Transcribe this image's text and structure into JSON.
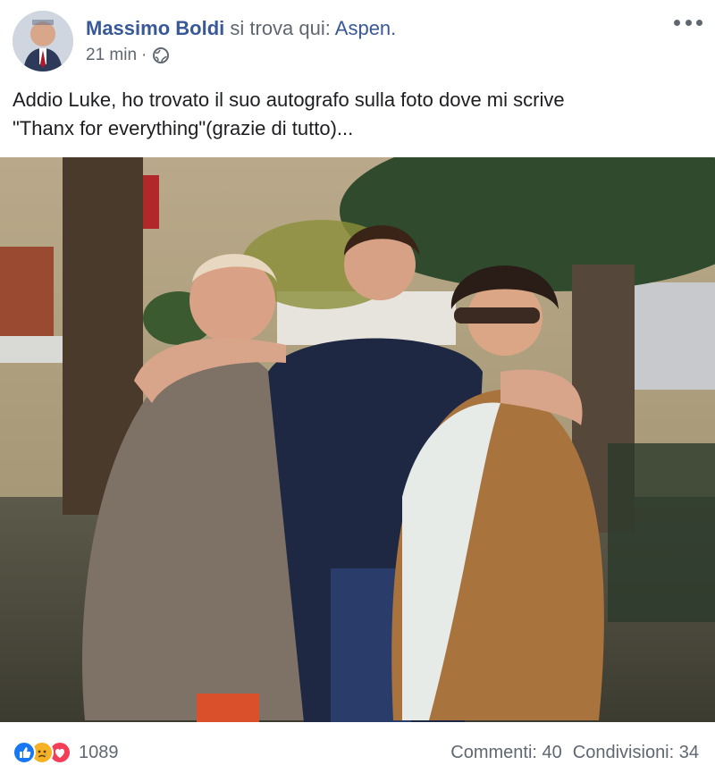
{
  "header": {
    "author_name": "Massimo Boldi",
    "location_prefix": "si trova qui:",
    "location_name": "Aspen.",
    "timestamp": "21 min",
    "separator": "·",
    "privacy_icon": "globe-icon",
    "more_icon": "more-options-icon"
  },
  "post": {
    "text": "Addio Luke, ho trovato il suo autografo sulla foto dove mi scrive\n\"Thanx for everything\"(grazie di tutto)..."
  },
  "footer": {
    "reaction_icons": [
      "like-icon",
      "sad-icon",
      "love-icon"
    ],
    "reaction_count": "1089",
    "comments": "Commenti: 40",
    "shares": "Condivisioni: 34"
  },
  "colors": {
    "link_blue": "#385898",
    "meta_gray": "#606770",
    "like_blue": "#1877f2",
    "sad_yellow": "#f7b125",
    "love_red": "#f33e58"
  }
}
